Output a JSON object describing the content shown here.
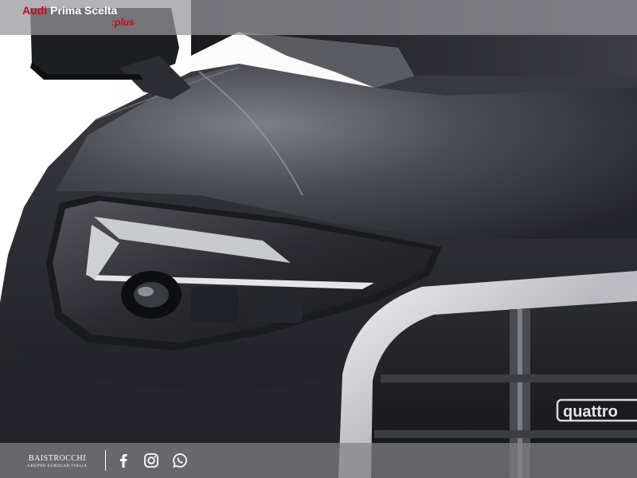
{
  "header": {
    "brand_audi": "Audi",
    "brand_prima": "Prima Scelta",
    "brand_plus": ":plus"
  },
  "footer": {
    "dealer_name": "BAISTROCCHI",
    "dealer_subtitle": "GRUPPO EUROCAR ITALIA",
    "social": [
      "facebook-icon",
      "instagram-icon",
      "whatsapp-icon"
    ]
  },
  "car": {
    "badge_text": "quattro"
  },
  "colors": {
    "accent": "#d0021b",
    "car_body": "#2b2c33",
    "bar": "#96969b"
  }
}
